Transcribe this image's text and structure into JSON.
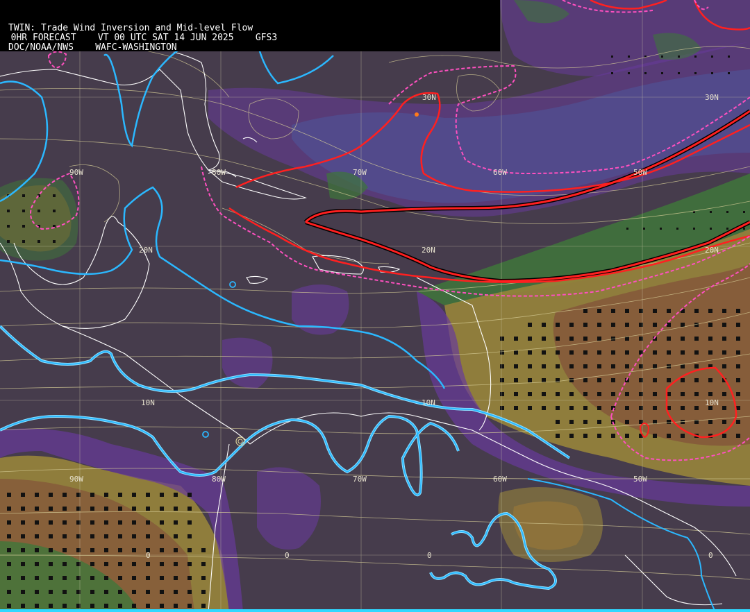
{
  "header": {
    "title": "TWIN: Trade Wind Inversion and Mid-level Flow",
    "forecast_line": "  0HR FORECAST    VT 00 UTC SAT 14 JUN 2025    GFS3",
    "source_line": "DOC/NOAA/NWS    WAFC-WASHINGTON"
  },
  "grid_labels": {
    "lat_30n_a": "30N",
    "lat_30n_b": "30N",
    "lat_20n_a": "20N",
    "lat_20n_b": "20N",
    "lat_20n_c": "20N",
    "lat_10n_a": "10N",
    "lat_10n_b": "10N",
    "lat_10n_c": "10N",
    "lon_90w_a": "90W",
    "lon_80w_a": "80W",
    "lon_70w_a": "70W",
    "lon_60w_a": "60W",
    "lon_50w_a": "50W",
    "lon_90w_b": "90W",
    "lon_80w_b": "80W",
    "lon_70w_b": "70W",
    "lon_60w_b": "60W",
    "lon_50w_b": "50W",
    "eq_a": "0",
    "eq_b": "0",
    "eq_c": "0",
    "eq_d": "0"
  },
  "colors": {
    "background": "#463c4c",
    "purple_shade": "#7a3fb0",
    "blue_shade": "#4f5aa0",
    "green_shade": "#3f7a3a",
    "yellow_shade": "#9c8a3a",
    "brown_shade": "#8a5a3a",
    "streamline": "#d8cf98",
    "coast": "#ffffff",
    "contour_cyan": "#2bb8ff",
    "contour_red": "#ff2020",
    "contour_magenta_dashed": "#ff50c0",
    "grid": "#cfc9a8",
    "header_bg": "#000000",
    "header_text": "#ffffff"
  }
}
